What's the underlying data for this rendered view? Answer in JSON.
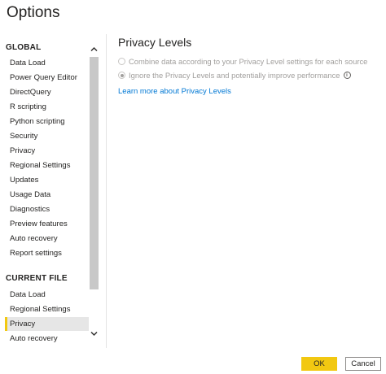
{
  "dialog": {
    "title": "Options"
  },
  "sidebar": {
    "global_header": "GLOBAL",
    "global_items": [
      "Data Load",
      "Power Query Editor",
      "DirectQuery",
      "R scripting",
      "Python scripting",
      "Security",
      "Privacy",
      "Regional Settings",
      "Updates",
      "Usage Data",
      "Diagnostics",
      "Preview features",
      "Auto recovery",
      "Report settings"
    ],
    "current_header": "CURRENT FILE",
    "current_items": [
      "Data Load",
      "Regional Settings",
      "Privacy",
      "Auto recovery"
    ],
    "selected": "current:Privacy"
  },
  "content": {
    "title": "Privacy Levels",
    "option_combine": "Combine data according to your Privacy Level settings for each source",
    "option_ignore": "Ignore the Privacy Levels and potentially improve performance",
    "selected_option": "ignore",
    "learn_more": "Learn more about Privacy Levels"
  },
  "buttons": {
    "ok": "OK",
    "cancel": "Cancel"
  },
  "colors": {
    "accent": "#f2c811",
    "link": "#0078d4",
    "selected_bg": "#e6e6e6"
  }
}
